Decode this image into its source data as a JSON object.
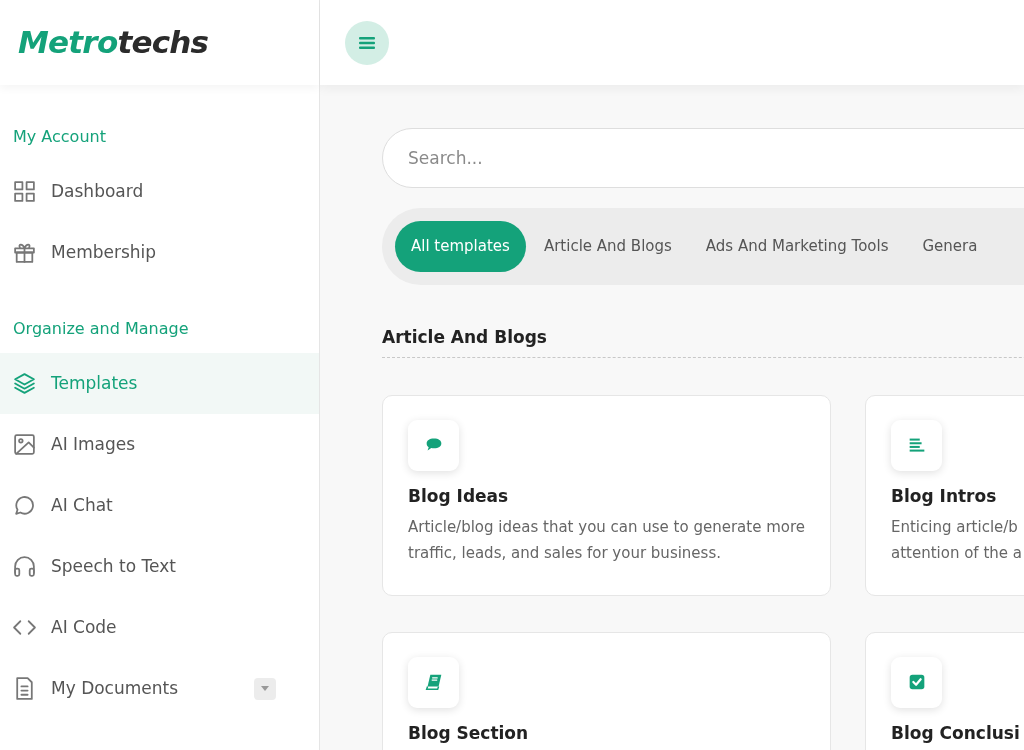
{
  "logo": {
    "primary": "Metro",
    "secondary": "techs"
  },
  "sidebar": {
    "sections": [
      {
        "heading": "My Account",
        "items": [
          {
            "label": "Dashboard",
            "kind": "grid",
            "selected": false,
            "has_submenu": false
          },
          {
            "label": "Membership",
            "kind": "gift",
            "selected": false,
            "has_submenu": false
          }
        ]
      },
      {
        "heading": "Organize and Manage",
        "items": [
          {
            "label": "Templates",
            "kind": "layers",
            "selected": true,
            "has_submenu": false
          },
          {
            "label": "AI Images",
            "kind": "image",
            "selected": false,
            "has_submenu": false
          },
          {
            "label": "AI Chat",
            "kind": "chat",
            "selected": false,
            "has_submenu": false
          },
          {
            "label": "Speech to Text",
            "kind": "headphones",
            "selected": false,
            "has_submenu": false
          },
          {
            "label": "AI Code",
            "kind": "code",
            "selected": false,
            "has_submenu": false
          },
          {
            "label": "My Documents",
            "kind": "document",
            "selected": false,
            "has_submenu": true
          }
        ]
      }
    ]
  },
  "search": {
    "placeholder": "Search..."
  },
  "tabs": [
    {
      "label": "All templates",
      "selected": true
    },
    {
      "label": "Article And Blogs",
      "selected": false
    },
    {
      "label": "Ads And Marketing Tools",
      "selected": false
    },
    {
      "label": "Genera",
      "selected": false
    }
  ],
  "section_title": "Article And Blogs",
  "cards": [
    {
      "title": "Blog Ideas",
      "description": "Article/blog ideas that you can use to generate more traffic, leads, and sales for your business.",
      "kind": "chat"
    },
    {
      "title": "Blog Intros",
      "description": "Enticing article/b\nattention of the a",
      "kind": "lines"
    },
    {
      "title": "Blog Section",
      "kind": "book"
    },
    {
      "title": "Blog Conclusi",
      "kind": "check"
    }
  ]
}
